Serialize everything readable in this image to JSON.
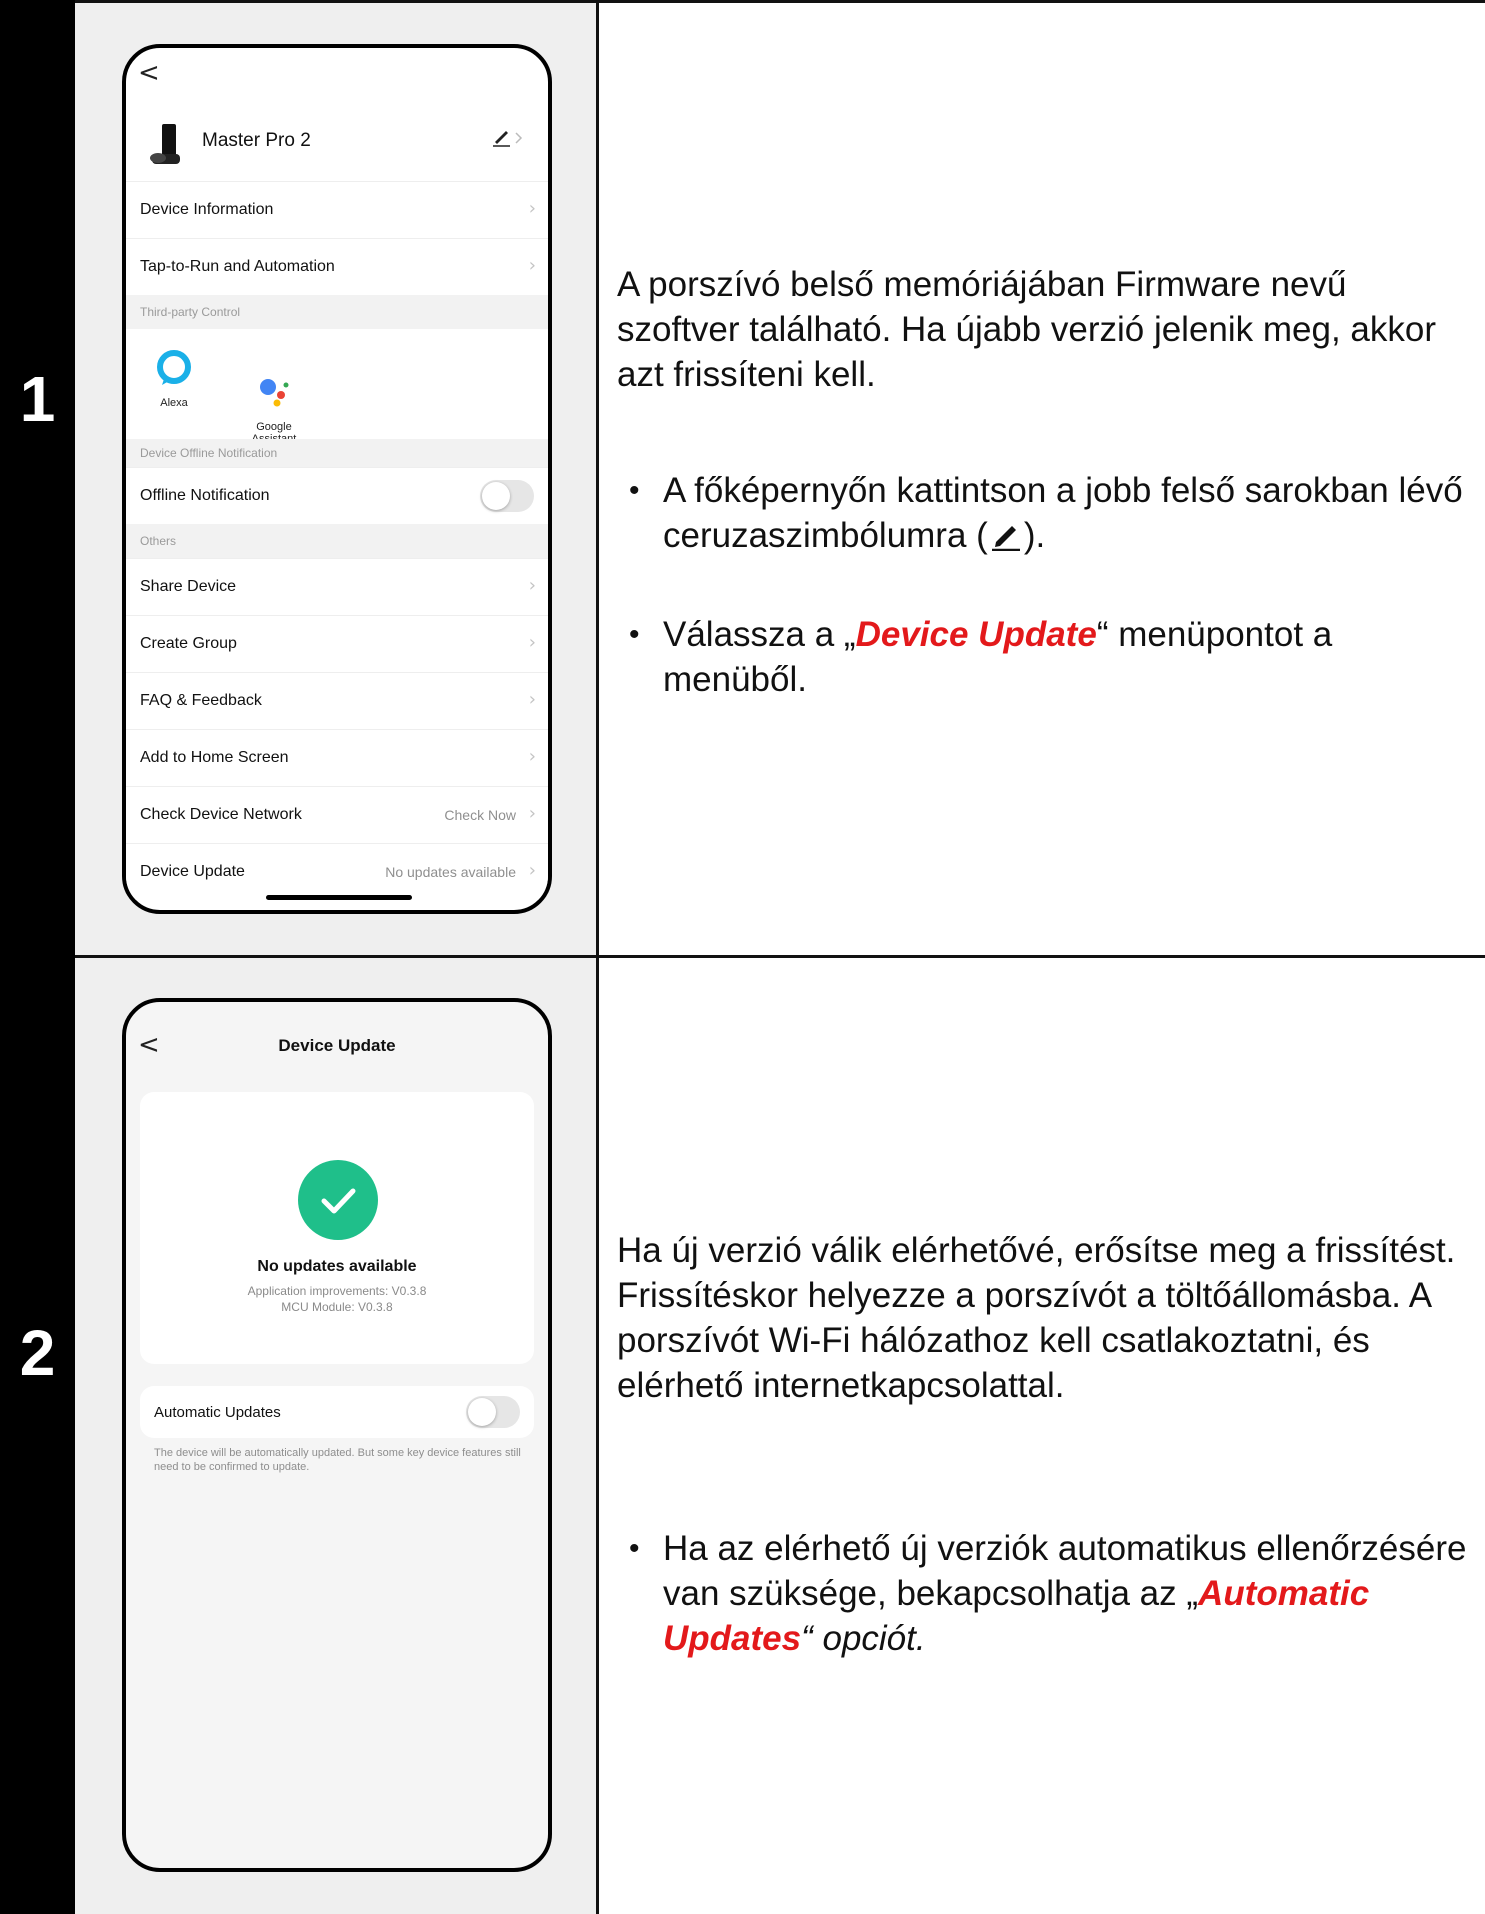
{
  "steps": [
    {
      "number": "1",
      "screen": {
        "back": "<",
        "device_name": "Master Pro 2",
        "rows": [
          {
            "label": "Device Information"
          },
          {
            "label": "Tap-to-Run and Automation"
          }
        ],
        "section_third_party": "Third-party Control",
        "third_party": [
          {
            "label": "Alexa"
          },
          {
            "label": "Google\nAssistant"
          }
        ],
        "section_offline": "Device Offline Notification",
        "offline_label": "Offline Notification",
        "section_others": "Others",
        "other_rows": [
          {
            "label": "Share Device",
            "value": ""
          },
          {
            "label": "Create Group",
            "value": ""
          },
          {
            "label": "FAQ & Feedback",
            "value": ""
          },
          {
            "label": "Add to Home Screen",
            "value": ""
          },
          {
            "label": "Check Device Network",
            "value": "Check Now"
          },
          {
            "label": "Device Update",
            "value": "No updates available"
          }
        ]
      },
      "text": {
        "intro": "A porszívó belső memóriájában Firmware nevű szoftver található. Ha újabb verzió jelenik meg, akkor azt frissíteni kell.",
        "bullet1_a": "A főképernyőn kattintson a jobb felső sarokban lévő ceruzaszimbólumra (",
        "bullet1_b": ").",
        "bullet2_a": "Válassza a „",
        "bullet2_em": "Device Update",
        "bullet2_b": "“ menüpontot a menüből."
      }
    },
    {
      "number": "2",
      "screen": {
        "back": "<",
        "title": "Device Update",
        "status": "No updates available",
        "app_version": "Application improvements: V0.3.8",
        "mcu_version": "MCU Module: V0.3.8",
        "auto_label": "Automatic Updates",
        "auto_note": "The device will be automatically updated. But some key device features still need to be confirmed to update."
      },
      "text": {
        "intro": "Ha új verzió válik elérhetővé, erősítse meg a frissítést. Frissítéskor helyezze a porszívót a töltőállomásba. A porszívót Wi-Fi hálózathoz kell csatlakoztatni, és elérhető internetkapcsolattal.",
        "bullet1_a": "Ha az elérhető új verziók automatikus ellenőrzésére van szüksége, bekapcsolhatja az „",
        "bullet1_em": "Automatic Updates",
        "bullet1_b": "“ opciót."
      }
    }
  ],
  "colors": {
    "accent_red": "#e3191b",
    "success_green": "#1fbf8a",
    "alexa_blue": "#1ab0e8"
  },
  "icons": [
    "chevron-left-icon",
    "pencil-icon",
    "chevron-right-icon",
    "alexa-icon",
    "google-assistant-icon",
    "checkmark-icon",
    "robot-vacuum-image"
  ]
}
